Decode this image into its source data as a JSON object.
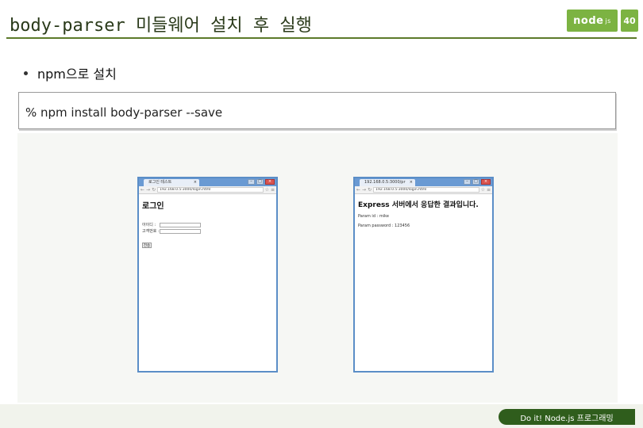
{
  "slide": {
    "title": "body-parser 미들웨어 설치 후 실행",
    "page_number": "40",
    "logo_text": "node",
    "logo_suffix": "js"
  },
  "content": {
    "bullet": "npm으로 설치",
    "command": "% npm install body-parser --save"
  },
  "browser_left": {
    "tab_title": "로그인 테스트",
    "url": "192.168.0.5:3000/login.html",
    "heading": "로그인",
    "id_label": "아이디 :",
    "password_label": "고객번호 :",
    "submit_label": "전송"
  },
  "browser_right": {
    "tab_title": "192.168.0.5:3000/pr",
    "url": "192.168.0.5:3000/login.html",
    "heading": "Express 서버에서 응답한 결과입니다.",
    "param_id": "Param id : mike",
    "param_password": "Param password : 123456"
  },
  "footer": {
    "label": "Do it! Node.js 프로그래밍"
  },
  "colors": {
    "accent_green": "#7cb342",
    "dark_green": "#2f5d1c",
    "browser_blue": "#5b8ec7"
  }
}
